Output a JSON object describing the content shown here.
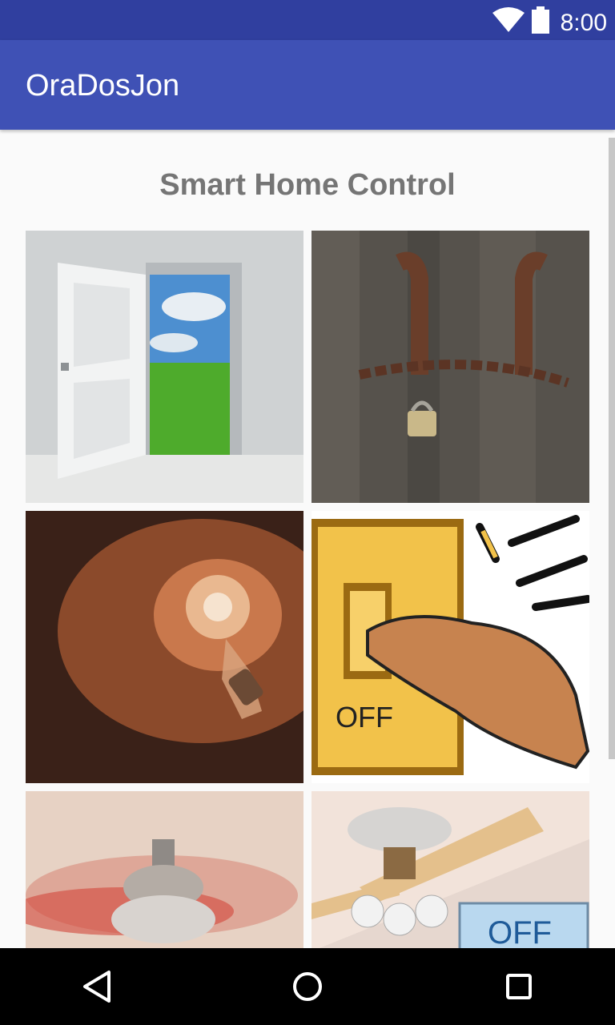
{
  "status_bar": {
    "time": "8:00",
    "icons": [
      "wifi-icon",
      "battery-icon"
    ]
  },
  "app_bar": {
    "title": "OraDosJon"
  },
  "main": {
    "heading": "Smart Home Control",
    "tiles": [
      {
        "name": "open-door-image"
      },
      {
        "name": "locked-door-image",
        "text": ""
      },
      {
        "name": "light-bulb-image"
      },
      {
        "name": "light-switch-off-image",
        "text": "OFF"
      },
      {
        "name": "ceiling-fan-spinning-image"
      },
      {
        "name": "ceiling-fan-off-image",
        "text": "OFF"
      }
    ]
  },
  "nav_bar": {
    "icons": [
      "back-icon",
      "home-icon",
      "recents-icon"
    ]
  },
  "colors": {
    "status_bar": "#303f9f",
    "app_bar": "#3f51b5",
    "background": "#fafafa",
    "heading": "#757575"
  }
}
